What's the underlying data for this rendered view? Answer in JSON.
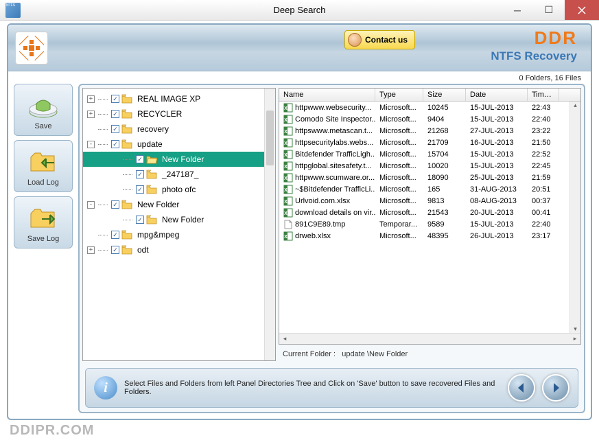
{
  "titlebar": {
    "title": "Deep Search"
  },
  "banner": {
    "contact_label": "Contact us",
    "brand": "DDR",
    "brand_sub": "NTFS Recovery"
  },
  "status": "0 Folders, 16 Files",
  "tools": {
    "save": "Save",
    "load_log": "Load Log",
    "save_log": "Save Log"
  },
  "tree": [
    {
      "level": 0,
      "expander": "+",
      "checked": true,
      "label": "REAL IMAGE XP"
    },
    {
      "level": 0,
      "expander": "+",
      "checked": true,
      "label": "RECYCLER"
    },
    {
      "level": 0,
      "expander": "",
      "checked": true,
      "label": "recovery"
    },
    {
      "level": 0,
      "expander": "-",
      "checked": true,
      "label": "update"
    },
    {
      "level": 1,
      "expander": "",
      "checked": true,
      "label": "New Folder",
      "selected": true,
      "open": true
    },
    {
      "level": 1,
      "expander": "",
      "checked": true,
      "label": "_247187_"
    },
    {
      "level": 1,
      "expander": "",
      "checked": true,
      "label": "photo ofc"
    },
    {
      "level": 0,
      "expander": "-",
      "checked": true,
      "label": "New Folder"
    },
    {
      "level": 1,
      "expander": "",
      "checked": true,
      "label": "New Folder"
    },
    {
      "level": 0,
      "expander": "",
      "checked": true,
      "label": "mpg&mpeg"
    },
    {
      "level": 0,
      "expander": "+",
      "checked": true,
      "label": "odt"
    }
  ],
  "columns": {
    "name": "Name",
    "type": "Type",
    "size": "Size",
    "date": "Date",
    "time": "Time"
  },
  "files": [
    {
      "icon": "xls",
      "name": "httpwww.websecurity...",
      "type": "Microsoft...",
      "size": "10245",
      "date": "15-JUL-2013",
      "time": "22:43"
    },
    {
      "icon": "xls",
      "name": "Comodo Site Inspector...",
      "type": "Microsoft...",
      "size": "9404",
      "date": "15-JUL-2013",
      "time": "22:40"
    },
    {
      "icon": "xls",
      "name": "httpswww.metascan.t...",
      "type": "Microsoft...",
      "size": "21268",
      "date": "27-JUL-2013",
      "time": "23:22"
    },
    {
      "icon": "xls",
      "name": "httpsecuritylabs.webs...",
      "type": "Microsoft...",
      "size": "21709",
      "date": "16-JUL-2013",
      "time": "21:50"
    },
    {
      "icon": "xls",
      "name": "Bitdefender TrafficLigh...",
      "type": "Microsoft...",
      "size": "15704",
      "date": "15-JUL-2013",
      "time": "22:52"
    },
    {
      "icon": "xls",
      "name": "httpglobal.sitesafety.t...",
      "type": "Microsoft...",
      "size": "10020",
      "date": "15-JUL-2013",
      "time": "22:45"
    },
    {
      "icon": "xls",
      "name": "httpwww.scumware.or...",
      "type": "Microsoft...",
      "size": "18090",
      "date": "25-JUL-2013",
      "time": "21:59"
    },
    {
      "icon": "xls",
      "name": "~$Bitdefender TrafficLi...",
      "type": "Microsoft...",
      "size": "165",
      "date": "31-AUG-2013",
      "time": "20:51"
    },
    {
      "icon": "xls",
      "name": "Urlvoid.com.xlsx",
      "type": "Microsoft...",
      "size": "9813",
      "date": "08-AUG-2013",
      "time": "00:37"
    },
    {
      "icon": "xls",
      "name": "download details on vir...",
      "type": "Microsoft...",
      "size": "21543",
      "date": "20-JUL-2013",
      "time": "00:41"
    },
    {
      "icon": "tmp",
      "name": "891C9E89.tmp",
      "type": "Temporar...",
      "size": "9589",
      "date": "15-JUL-2013",
      "time": "22:40"
    },
    {
      "icon": "xls",
      "name": "drweb.xlsx",
      "type": "Microsoft...",
      "size": "48395",
      "date": "26-JUL-2013",
      "time": "23:17"
    }
  ],
  "current_folder_label": "Current Folder :",
  "current_folder_path": "update \\New Folder",
  "footer_text": "Select Files and Folders from left Panel Directories Tree and Click on 'Save' button to save recovered Files and Folders.",
  "watermark": "DDIPR.COM"
}
